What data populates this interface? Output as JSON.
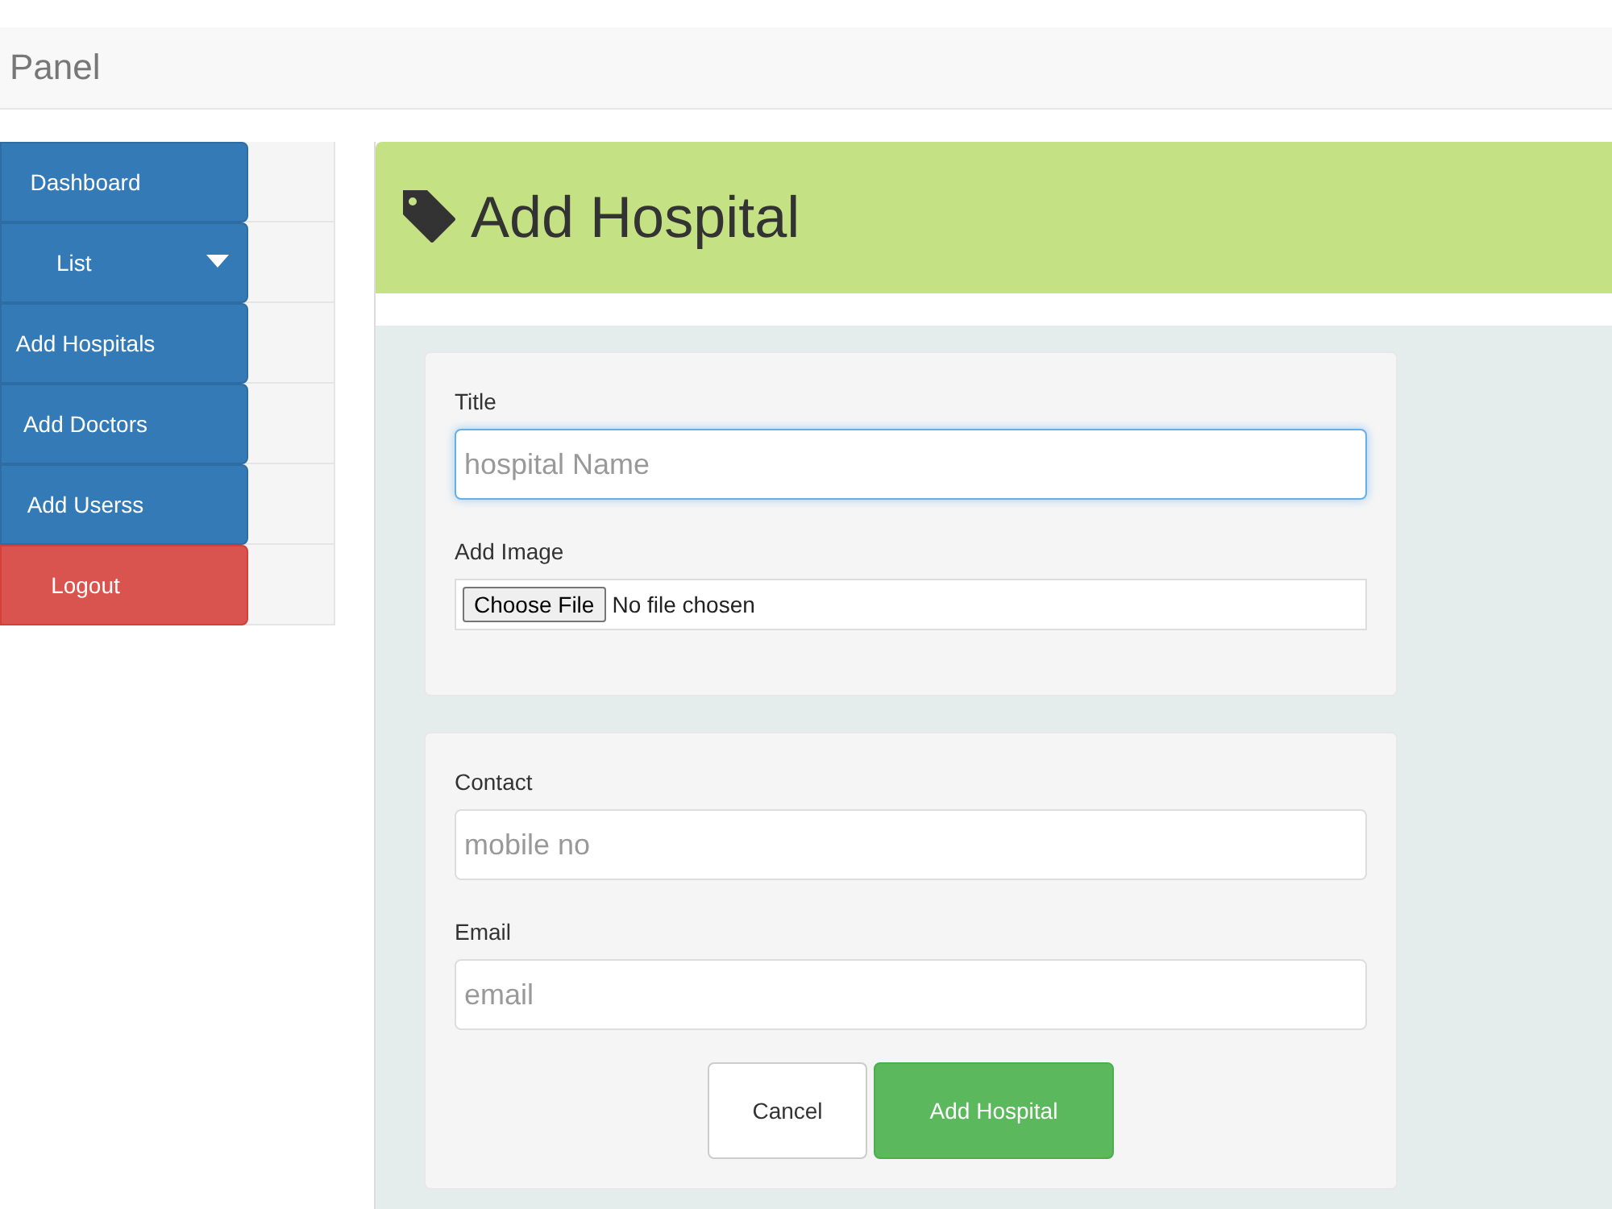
{
  "navbar": {
    "brand": "Panel"
  },
  "sidebar": {
    "items": [
      {
        "label": "Dashboard",
        "kind": "link"
      },
      {
        "label": "List",
        "kind": "dropdown"
      },
      {
        "label": "Add Hospitals",
        "kind": "link"
      },
      {
        "label": "Add Doctors",
        "kind": "link"
      },
      {
        "label": "Add Userss",
        "kind": "link"
      },
      {
        "label": "Logout",
        "kind": "danger"
      }
    ]
  },
  "page_header": {
    "title": "Add Hospital"
  },
  "form": {
    "sections": [
      {
        "fields": [
          {
            "kind": "text",
            "label": "Title",
            "placeholder": "hospital Name",
            "focused": true
          },
          {
            "kind": "file",
            "label": "Add Image",
            "button": "Choose File",
            "status": "No file chosen"
          }
        ]
      },
      {
        "fields": [
          {
            "kind": "text",
            "label": "Contact",
            "placeholder": "mobile no",
            "focused": false
          },
          {
            "kind": "text",
            "label": "Email",
            "placeholder": "email",
            "focused": false
          }
        ],
        "buttons": [
          {
            "label": "Cancel",
            "kind": "default"
          },
          {
            "label": "Add Hospital",
            "kind": "primary"
          }
        ]
      }
    ]
  }
}
